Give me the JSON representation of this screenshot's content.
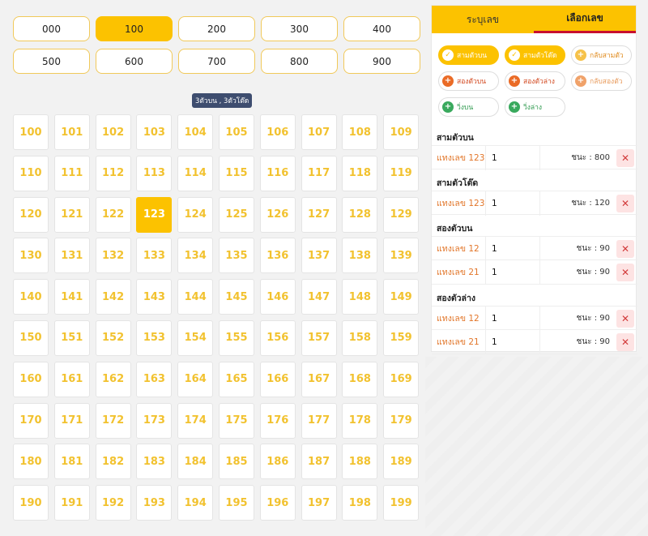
{
  "hundreds": [
    {
      "label": "000",
      "active": false
    },
    {
      "label": "100",
      "active": true
    },
    {
      "label": "200",
      "active": false
    },
    {
      "label": "300",
      "active": false
    },
    {
      "label": "400",
      "active": false
    },
    {
      "label": "500",
      "active": false
    },
    {
      "label": "600",
      "active": false
    },
    {
      "label": "700",
      "active": false
    },
    {
      "label": "800",
      "active": false
    },
    {
      "label": "900",
      "active": false
    }
  ],
  "selected_badge": "3ตัวบน , 3ตัวโต๊ด",
  "numbers": [
    "100",
    "101",
    "102",
    "103",
    "104",
    "105",
    "106",
    "107",
    "108",
    "109",
    "110",
    "111",
    "112",
    "113",
    "114",
    "115",
    "116",
    "117",
    "118",
    "119",
    "120",
    "121",
    "122",
    "123",
    "124",
    "125",
    "126",
    "127",
    "128",
    "129",
    "130",
    "131",
    "132",
    "133",
    "134",
    "135",
    "136",
    "137",
    "138",
    "139",
    "140",
    "141",
    "142",
    "143",
    "144",
    "145",
    "146",
    "147",
    "148",
    "149",
    "150",
    "151",
    "152",
    "153",
    "154",
    "155",
    "156",
    "157",
    "158",
    "159",
    "160",
    "161",
    "162",
    "163",
    "164",
    "165",
    "166",
    "167",
    "168",
    "169",
    "170",
    "171",
    "172",
    "173",
    "174",
    "175",
    "176",
    "177",
    "178",
    "179",
    "180",
    "181",
    "182",
    "183",
    "184",
    "185",
    "186",
    "187",
    "188",
    "189",
    "190",
    "191",
    "192",
    "193",
    "194",
    "195",
    "196",
    "197",
    "198",
    "199"
  ],
  "selected_number": "123",
  "tabs": [
    {
      "label": "ระบุเลข",
      "active": false
    },
    {
      "label": "เลือกเลข",
      "active": true
    }
  ],
  "bet_types": [
    {
      "label": "สามตัวบน",
      "style": "sel",
      "icon": "check-icon"
    },
    {
      "label": "สามตัวโต๊ด",
      "style": "sel",
      "icon": "check-icon"
    },
    {
      "label": "กลับสามตัว",
      "style": "opt",
      "icon": "plus-icon"
    },
    {
      "label": "สองตัวบน",
      "style": "two",
      "icon": "plus-icon"
    },
    {
      "label": "สองตัวล่าง",
      "style": "two",
      "icon": "plus-icon"
    },
    {
      "label": "กลับสองตัว",
      "style": "flip2",
      "icon": "plus-icon"
    },
    {
      "label": "วิ่งบน",
      "style": "run",
      "icon": "plus-icon"
    },
    {
      "label": "วิ่งล่าง",
      "style": "run",
      "icon": "plus-icon"
    }
  ],
  "bet_groups": [
    {
      "title": "สามตัวบน",
      "rows": [
        {
          "label": "แทงเลข 123",
          "qty": "1",
          "win": "ชนะ : 800"
        }
      ]
    },
    {
      "title": "สามตัวโต๊ด",
      "rows": [
        {
          "label": "แทงเลข 123",
          "qty": "1",
          "win": "ชนะ : 120"
        }
      ]
    },
    {
      "title": "สองตัวบน",
      "rows": [
        {
          "label": "แทงเลข 12",
          "qty": "1",
          "win": "ชนะ : 90"
        },
        {
          "label": "แทงเลข 21",
          "qty": "1",
          "win": "ชนะ : 90"
        }
      ]
    },
    {
      "title": "สองตัวล่าง",
      "rows": [
        {
          "label": "แทงเลข 12",
          "qty": "1",
          "win": "ชนะ : 90"
        },
        {
          "label": "แทงเลข 21",
          "qty": "1",
          "win": "ชนะ : 90"
        }
      ]
    }
  ],
  "delete_symbol": "✕",
  "colors": {
    "accent": "#fcc200",
    "tab_underline": "#c8102e",
    "number_text": "#f2c22f",
    "badge_bg": "#3e4d6f"
  }
}
